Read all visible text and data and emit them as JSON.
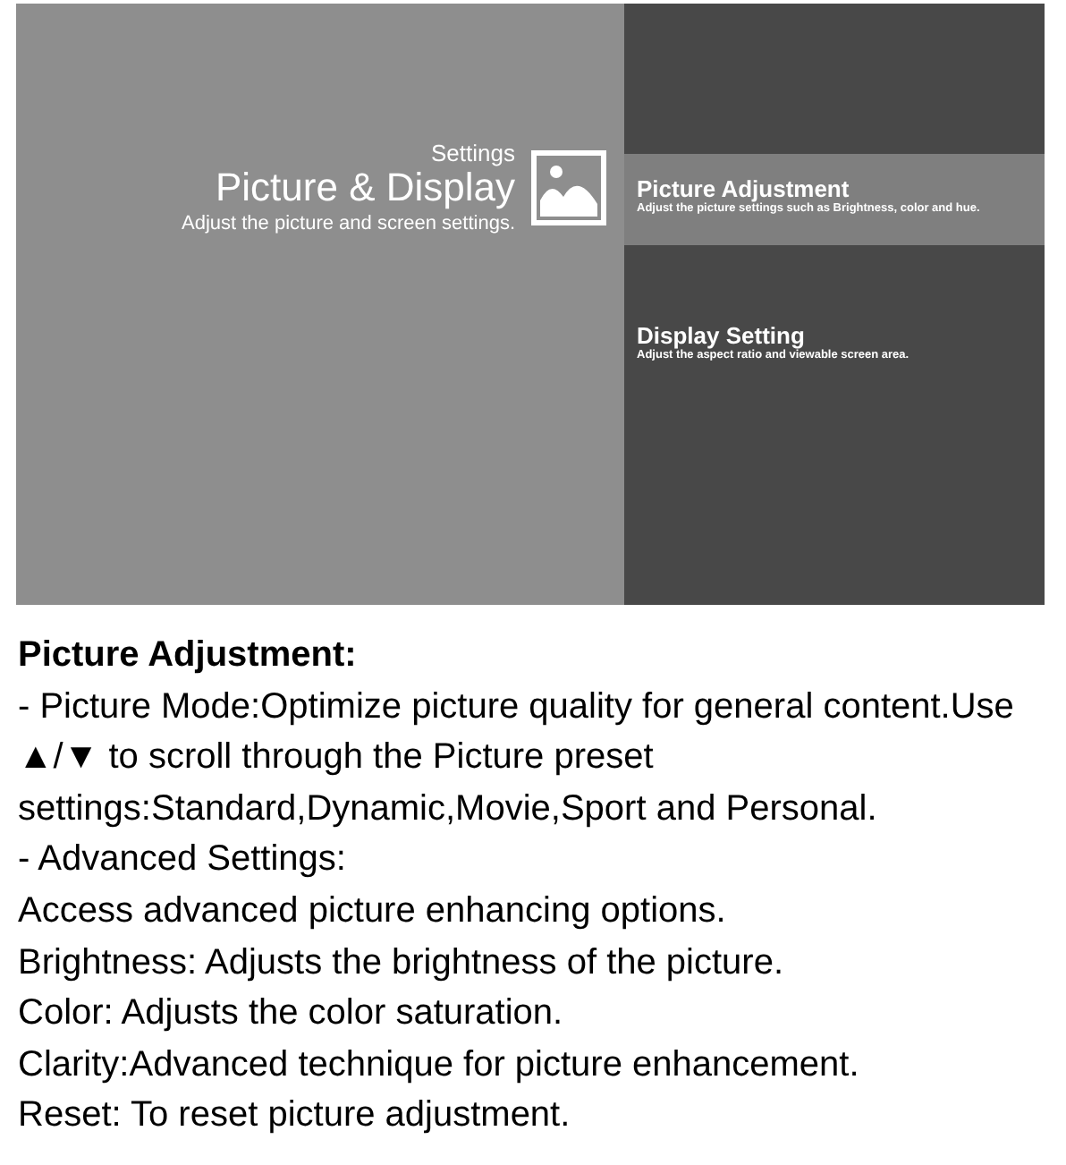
{
  "screen": {
    "header": {
      "breadcrumb": "Settings",
      "title": "Picture & Display",
      "subtitle": "Adjust the picture and screen settings."
    },
    "menu": [
      {
        "title": "Picture Adjustment",
        "description": "Adjust the picture settings such as Brightness, color and hue.",
        "selected": true
      },
      {
        "title": "Display Setting",
        "description": "Adjust the aspect ratio and viewable screen area.",
        "selected": false
      }
    ]
  },
  "manual": {
    "heading": "Picture Adjustment:",
    "paragraphs": [
      "-  Picture Mode:Optimize picture quality for general content.Use ▲/▼ to scroll through the Picture preset settings:Standard,Dynamic,Movie,Sport and Personal.",
      "- Advanced Settings:",
      "Access advanced picture enhancing options.",
      "Brightness: Adjusts the brightness of the picture.",
      "Color: Adjusts the color saturation.",
      "Clarity:Advanced technique for picture enhancement.",
      "Reset: To reset picture adjustment."
    ]
  }
}
